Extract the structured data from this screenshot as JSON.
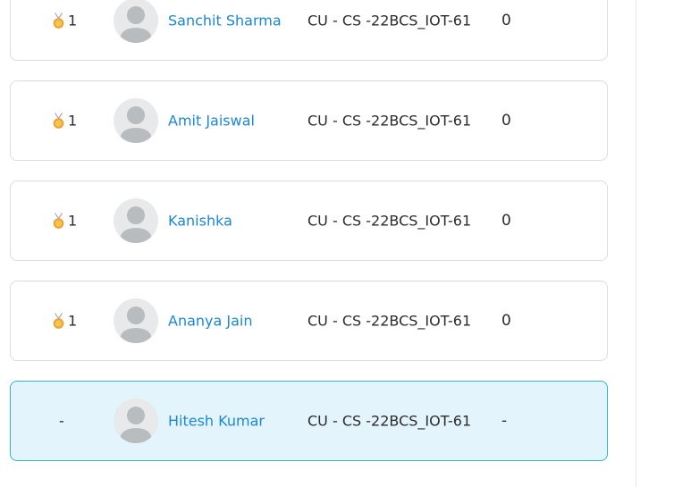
{
  "leaderboard": {
    "rows": [
      {
        "rank": "1",
        "name": "Sanchit Sharma",
        "group": "CU - CS -22BCS_IOT-61",
        "score": "0",
        "medal_icon": "medal-icon"
      },
      {
        "rank": "1",
        "name": "Amit Jaiswal",
        "group": "CU - CS -22BCS_IOT-61",
        "score": "0",
        "medal_icon": "medal-icon"
      },
      {
        "rank": "1",
        "name": "Kanishka",
        "group": "CU - CS -22BCS_IOT-61",
        "score": "0",
        "medal_icon": "medal-icon"
      },
      {
        "rank": "1",
        "name": "Ananya Jain",
        "group": "CU - CS -22BCS_IOT-61",
        "score": "0",
        "medal_icon": "medal-icon"
      },
      {
        "rank": "-",
        "name": "Hitesh Kumar",
        "group": "CU - CS -22BCS_IOT-61",
        "score": "-",
        "highlighted": true
      }
    ]
  },
  "colors": {
    "name_link": "#1b87d8",
    "highlight_bg": "#e3f4fd",
    "highlight_border": "#34b6c6",
    "row_border": "#dadde1"
  }
}
